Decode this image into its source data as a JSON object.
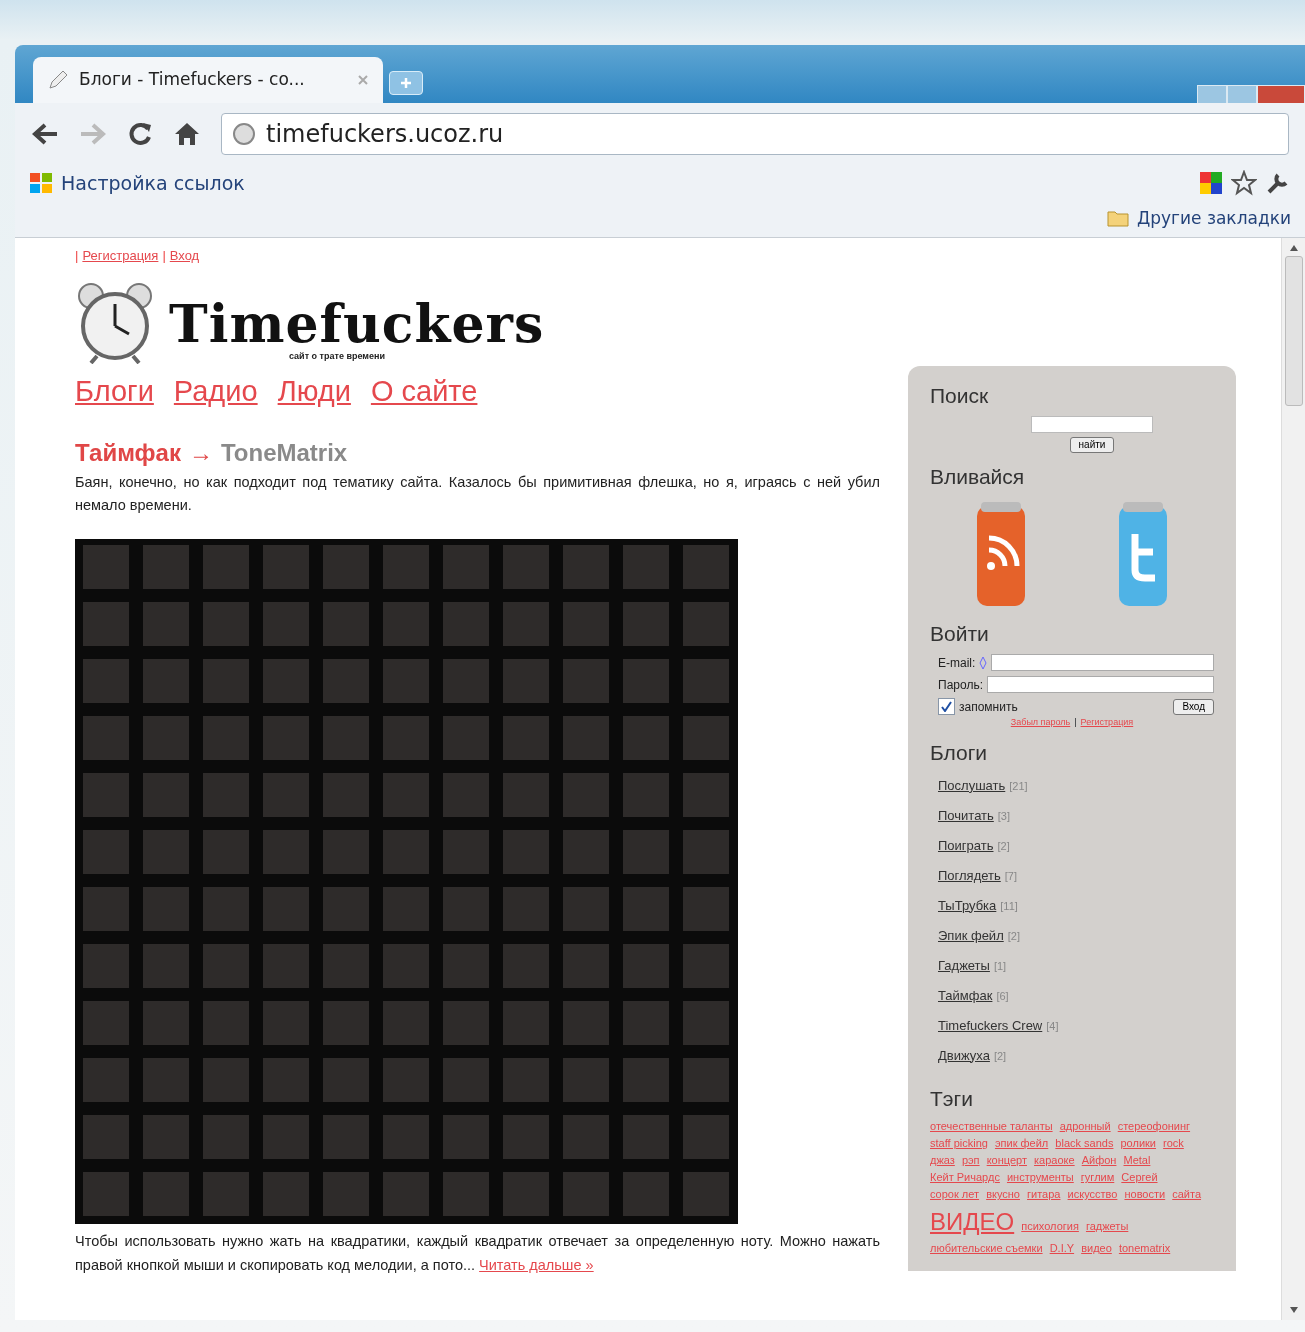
{
  "window": {
    "tab_title": "Блоги - Timefuckers - co...",
    "address": "timefuckers.ucoz.ru",
    "bookmarks": [
      {
        "label": "Настройка ссылок"
      }
    ],
    "other_bookmarks": "Другие закладки"
  },
  "page": {
    "top_links": [
      {
        "sep": "|",
        "label": "Регистрация"
      },
      {
        "sep": "|",
        "label": "Вход"
      }
    ],
    "logo_text": "Timefuckers",
    "logo_tagline": "сайт о трате времени",
    "nav": [
      "Блоги",
      "Радио",
      "Люди",
      "О сайте"
    ],
    "post": {
      "category": "Таймфак",
      "arrow": "→",
      "title": "ToneMatrix",
      "intro": "Баян, конечно, но как подходит под тематику сайта. Казалось бы примитивная флешка, но я, играясь с ней убил немало времени.",
      "body": "Чтобы использовать нужно жать на квадратики, каждый квадратик отвечает за определенную ноту. Можно нажать правой кнопкой мыши и скопировать код мелодии, а пото...",
      "read_more": "Читать дальше »"
    }
  },
  "sidebar": {
    "search": {
      "title": "Поиск",
      "button": "найти"
    },
    "follow": {
      "title": "Вливайся"
    },
    "login": {
      "title": "Войти",
      "email_label": "E-mail:",
      "password_label": "Пароль:",
      "remember": {
        "label": "запомнить",
        "checked": true
      },
      "button": "Вход",
      "links": [
        "Забыл пароль",
        "Регистрация"
      ],
      "link_separator": "|"
    },
    "blogs": {
      "title": "Блоги",
      "items": [
        {
          "label": "Послушать",
          "count": "[21]"
        },
        {
          "label": "Почитать",
          "count": "[3]"
        },
        {
          "label": "Поиграть",
          "count": "[2]"
        },
        {
          "label": "Поглядеть",
          "count": "[7]"
        },
        {
          "label": "ТыТрубка",
          "count": "[11]"
        },
        {
          "label": "Эпик фейл",
          "count": "[2]"
        },
        {
          "label": "Гаджеты",
          "count": "[1]"
        },
        {
          "label": "Таймфак",
          "count": "[6]"
        },
        {
          "label": "Timefuckers Crew",
          "count": "[4]"
        },
        {
          "label": "Движуха",
          "count": "[2]"
        }
      ]
    },
    "tags": {
      "title": "Тэги",
      "items": [
        {
          "label": "отечественные таланты",
          "kind": "normal"
        },
        {
          "label": "адронный",
          "kind": "normal"
        },
        {
          "label": "стереофонинг",
          "kind": "normal"
        },
        {
          "label": "staff picking",
          "kind": "normal"
        },
        {
          "label": "эпик фейл",
          "kind": "normal"
        },
        {
          "label": "black sands",
          "kind": "normal"
        },
        {
          "label": "ролики",
          "kind": "normal"
        },
        {
          "label": "rock",
          "kind": "normal"
        },
        {
          "label": "джаз",
          "kind": "normal"
        },
        {
          "label": "рэп",
          "kind": "normal"
        },
        {
          "label": "концерт",
          "kind": "normal"
        },
        {
          "label": "караоке",
          "kind": "normal"
        },
        {
          "label": "Айфон",
          "kind": "normal"
        },
        {
          "label": "Metal",
          "kind": "normal"
        },
        {
          "label": "Кейт Ричардс",
          "kind": "normal"
        },
        {
          "label": "инструменты",
          "kind": "normal"
        },
        {
          "label": "гуглим",
          "kind": "normal"
        },
        {
          "label": "Сергей",
          "kind": "normal"
        },
        {
          "label": "сорок лет",
          "kind": "normal"
        },
        {
          "label": "вкусно",
          "kind": "normal"
        },
        {
          "label": "гитара",
          "kind": "normal"
        },
        {
          "label": "искусство",
          "kind": "normal"
        },
        {
          "label": "новости",
          "kind": "normal"
        },
        {
          "label": "сайта",
          "kind": "normal"
        },
        {
          "label": "ВИДЕО",
          "kind": "large"
        },
        {
          "label": "психология",
          "kind": "normal"
        },
        {
          "label": "гаджеты",
          "kind": "normal"
        },
        {
          "label": "любительские съемки",
          "kind": "normal"
        },
        {
          "label": "D.I.Y",
          "kind": "normal"
        },
        {
          "label": "видео",
          "kind": "normal"
        },
        {
          "label": "tonematrix",
          "kind": "normal"
        }
      ]
    }
  }
}
